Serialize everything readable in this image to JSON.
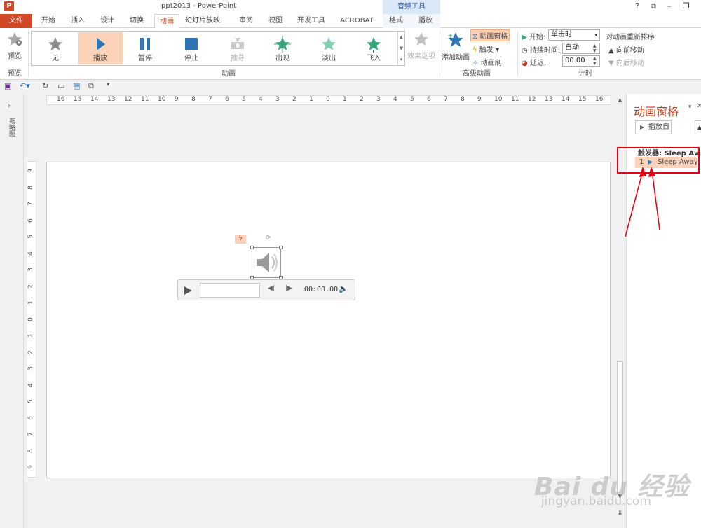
{
  "window": {
    "title": "ppt2013 - PowerPoint",
    "context_group": "音频工具",
    "controls": [
      "?",
      "⧉",
      "–",
      "❐",
      "✕"
    ]
  },
  "ribbon": {
    "tabs": [
      "文件",
      "开始",
      "插入",
      "设计",
      "切换",
      "动画",
      "幻灯片放映",
      "审阅",
      "视图",
      "开发工具",
      "ACROBAT",
      "格式",
      "播放"
    ],
    "active_tab": "动画",
    "preview": {
      "label": "预览",
      "group_label": "预览"
    },
    "animation_gallery": {
      "items": [
        {
          "label": "无",
          "icon": "star-gray-icon"
        },
        {
          "label": "播放",
          "icon": "play-icon"
        },
        {
          "label": "暂停",
          "icon": "pause-icon"
        },
        {
          "label": "停止",
          "icon": "stop-icon"
        },
        {
          "label": "搜寻",
          "icon": "seek-icon"
        },
        {
          "label": "出现",
          "icon": "appear-star-icon"
        },
        {
          "label": "淡出",
          "icon": "fade-star-icon"
        },
        {
          "label": "飞入",
          "icon": "fly-in-star-icon"
        }
      ],
      "selected_index": 1,
      "effect_options": "效果选项",
      "group_label": "动画"
    },
    "advanced": {
      "add_animation": "添加动画",
      "animation_pane": "动画窗格",
      "trigger": "触发",
      "animation_painter": "动画刷",
      "group_label": "高级动画"
    },
    "timing": {
      "start_label": "开始:",
      "start_value": "单击时",
      "duration_label": "持续时间:",
      "duration_value": "自动",
      "delay_label": "延迟:",
      "delay_value": "00.00",
      "reorder_label": "对动画重新排序",
      "move_earlier": "向前移动",
      "move_later": "向后移动",
      "group_label": "计时"
    }
  },
  "left_pane": {
    "label": "缩略图"
  },
  "rulers": {
    "horizontal": [
      "16",
      "15",
      "14",
      "13",
      "12",
      "11",
      "10",
      "9",
      "8",
      "7",
      "6",
      "5",
      "4",
      "3",
      "2",
      "1",
      "0",
      "1",
      "2",
      "3",
      "4",
      "5",
      "6",
      "7",
      "8",
      "9",
      "10",
      "11",
      "12",
      "13",
      "14",
      "15",
      "16"
    ],
    "vertical": [
      "9",
      "8",
      "7",
      "6",
      "5",
      "4",
      "3",
      "2",
      "1",
      "0",
      "1",
      "2",
      "3",
      "4",
      "5",
      "6",
      "7",
      "8",
      "9"
    ]
  },
  "media_player": {
    "time": "00:00.00"
  },
  "animation_pane": {
    "title": "动画窗格",
    "play_from": "播放自",
    "trigger_label": "触发器: Sleep Away",
    "item_number": "1",
    "item_name": "Sleep Away"
  },
  "watermark": {
    "main": "Bai du 经验",
    "sub": "jingyan.baidu.com"
  },
  "colors": {
    "accent": "#c43e1c",
    "file_tab": "#d24726",
    "selection": "#fcd3b9",
    "highlight_box": "#e60012"
  }
}
